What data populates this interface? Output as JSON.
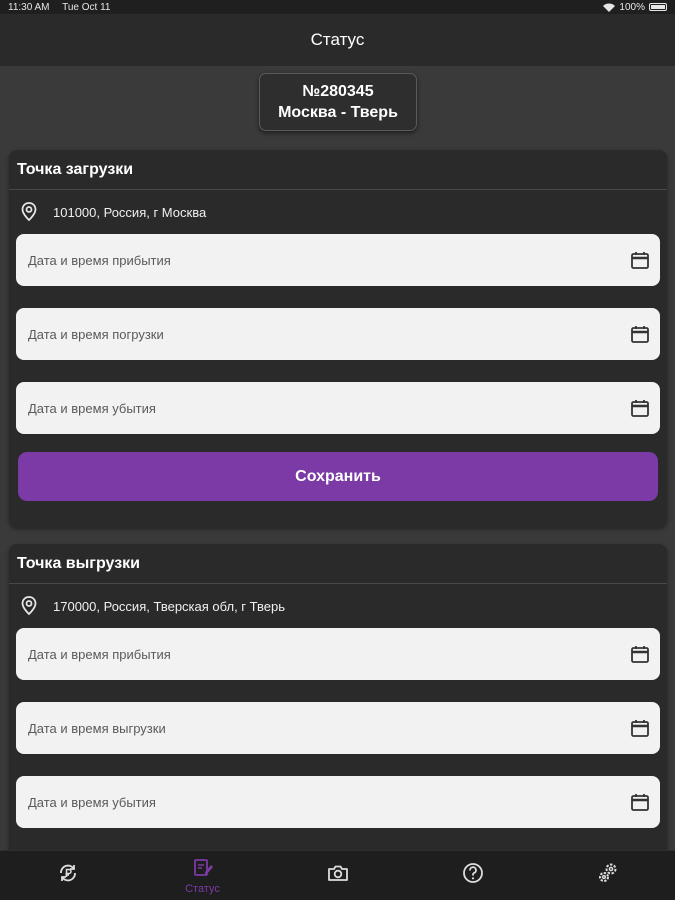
{
  "status_bar": {
    "time": "11:30 AM",
    "date": "Tue Oct 11",
    "battery": "100%"
  },
  "header": {
    "title": "Статус"
  },
  "order": {
    "number": "№280345",
    "route": "Москва - Тверь"
  },
  "loading_point": {
    "title": "Точка загрузки",
    "address": "101000, Россия, г Москва",
    "fields": [
      {
        "placeholder": "Дата и время прибытия"
      },
      {
        "placeholder": "Дата и время погрузки"
      },
      {
        "placeholder": "Дата и время убытия"
      }
    ],
    "save_label": "Сохранить"
  },
  "unloading_point": {
    "title": "Точка выгрузки",
    "address": "170000, Россия, Тверская обл, г Тверь",
    "fields": [
      {
        "placeholder": "Дата и время прибытия"
      },
      {
        "placeholder": "Дата и время выгрузки"
      },
      {
        "placeholder": "Дата и время убытия"
      }
    ]
  },
  "tabbar": {
    "tabs": [
      {
        "icon": "ruble-refresh-icon",
        "label": ""
      },
      {
        "icon": "status-edit-icon",
        "label": "Статус",
        "active": true
      },
      {
        "icon": "camera-icon",
        "label": ""
      },
      {
        "icon": "help-icon",
        "label": ""
      },
      {
        "icon": "settings-gears-icon",
        "label": ""
      }
    ]
  },
  "colors": {
    "accent": "#7b3aa5",
    "background": "#3a3a3a",
    "card": "#2a2a2a",
    "field": "#f2f2f2"
  }
}
